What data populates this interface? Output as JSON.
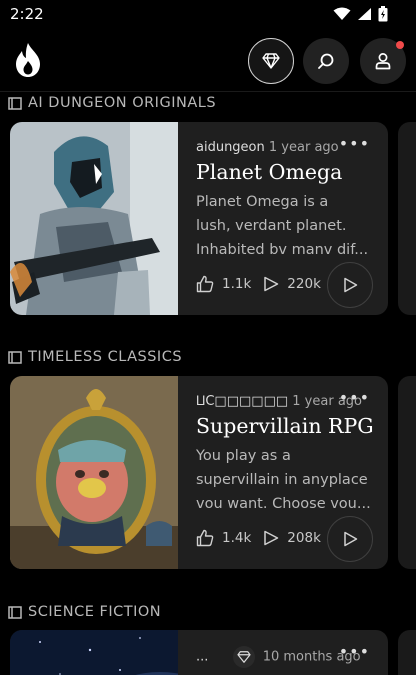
{
  "status": {
    "time": "2:22"
  },
  "header": {
    "logo": "flame-logo",
    "icons": [
      "gem-icon",
      "search-icon",
      "profile-icon"
    ]
  },
  "sections": [
    {
      "title": "AI DUNGEON ORIGINALS",
      "card": {
        "author": "aidungeon",
        "time": "1 year ago",
        "title": "Planet Omega",
        "desc_lines": [
          "Planet Omega is a",
          "lush, verdant planet.",
          "Inhabited bv manv dif..."
        ],
        "likes": "1.1k",
        "plays": "220k"
      }
    },
    {
      "title": "TIMELESS CLASSICS",
      "card": {
        "author": "⨿C□□□□□□",
        "time": "1 year ago",
        "title": "Supervillain RPG",
        "desc_lines": [
          "You play as a",
          "supervillain in anyplace",
          "vou want. Choose vou..."
        ],
        "likes": "1.4k",
        "plays": "208k"
      }
    },
    {
      "title": "SCIENCE FICTION",
      "card": {
        "author": "...",
        "time": "10 months ago"
      }
    }
  ],
  "colors": {
    "background": "#000000",
    "card": "#1f1f1f",
    "notification": "#f04a4a"
  }
}
